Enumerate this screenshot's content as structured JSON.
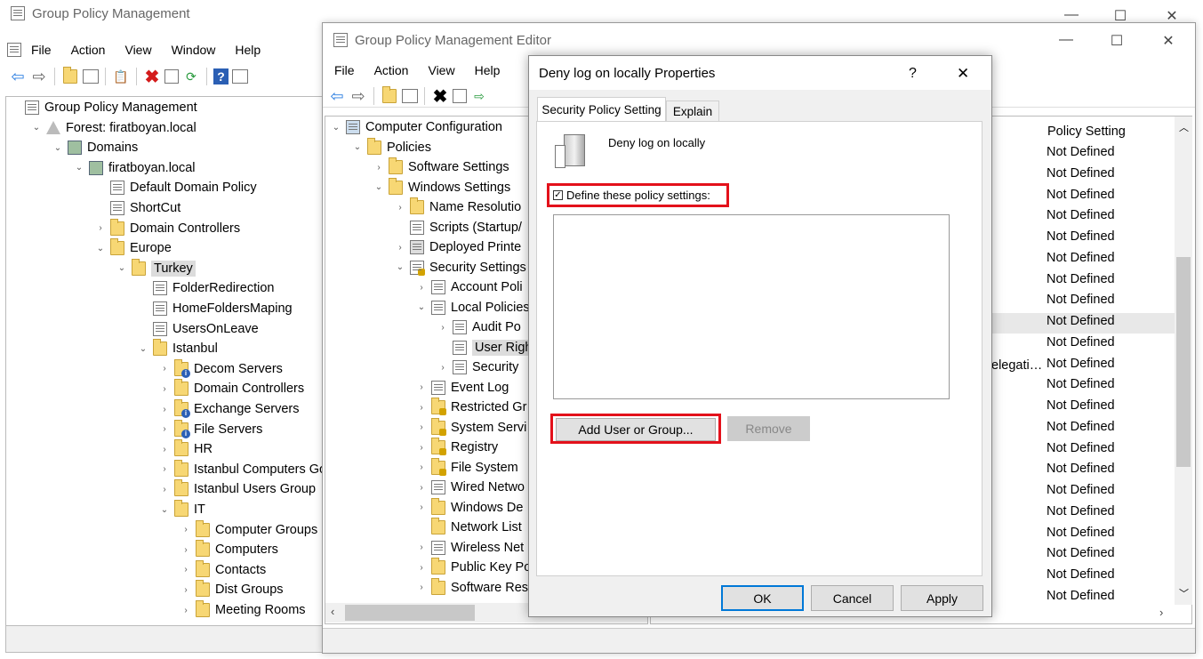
{
  "gpm": {
    "title": "Group Policy Management",
    "menu": [
      "File",
      "Action",
      "View",
      "Window",
      "Help"
    ],
    "tree": [
      {
        "label": "Group Policy Management",
        "indent": 0,
        "icon": "gpm",
        "arrow": ""
      },
      {
        "label": "Forest: firatboyan.local",
        "indent": 1,
        "icon": "forest",
        "arrow": "v"
      },
      {
        "label": "Domains",
        "indent": 2,
        "icon": "domains",
        "arrow": "v"
      },
      {
        "label": "firatboyan.local",
        "indent": 3,
        "icon": "domain",
        "arrow": "v"
      },
      {
        "label": "Default Domain Policy",
        "indent": 4,
        "icon": "gpo",
        "arrow": ""
      },
      {
        "label": "ShortCut",
        "indent": 4,
        "icon": "gpo",
        "arrow": ""
      },
      {
        "label": "Domain Controllers",
        "indent": 4,
        "icon": "folder",
        "arrow": ">"
      },
      {
        "label": "Europe",
        "indent": 4,
        "icon": "folder",
        "arrow": "v"
      },
      {
        "label": "Turkey",
        "indent": 5,
        "icon": "folder",
        "arrow": "v",
        "selected": true
      },
      {
        "label": "FolderRedirection",
        "indent": 6,
        "icon": "gpo",
        "arrow": ""
      },
      {
        "label": "HomeFoldersMaping",
        "indent": 6,
        "icon": "gpo",
        "arrow": ""
      },
      {
        "label": "UsersOnLeave",
        "indent": 6,
        "icon": "gpo",
        "arrow": ""
      },
      {
        "label": "Istanbul",
        "indent": 6,
        "icon": "folder",
        "arrow": "v"
      },
      {
        "label": "Decom Servers",
        "indent": 7,
        "icon": "folder-info",
        "arrow": ">"
      },
      {
        "label": "Domain Controllers",
        "indent": 7,
        "icon": "folder",
        "arrow": ">"
      },
      {
        "label": "Exchange Servers",
        "indent": 7,
        "icon": "folder-info",
        "arrow": ">"
      },
      {
        "label": "File Servers",
        "indent": 7,
        "icon": "folder-info",
        "arrow": ">"
      },
      {
        "label": "HR",
        "indent": 7,
        "icon": "folder",
        "arrow": ">"
      },
      {
        "label": "Istanbul Computers Gorc",
        "indent": 7,
        "icon": "folder",
        "arrow": ">"
      },
      {
        "label": "Istanbul Users Group",
        "indent": 7,
        "icon": "folder",
        "arrow": ">"
      },
      {
        "label": "IT",
        "indent": 7,
        "icon": "folder",
        "arrow": "v"
      },
      {
        "label": "Computer Groups",
        "indent": 8,
        "icon": "folder",
        "arrow": ">"
      },
      {
        "label": "Computers",
        "indent": 8,
        "icon": "folder",
        "arrow": ">"
      },
      {
        "label": "Contacts",
        "indent": 8,
        "icon": "folder",
        "arrow": ">"
      },
      {
        "label": "Dist Groups",
        "indent": 8,
        "icon": "folder",
        "arrow": ">"
      },
      {
        "label": "Meeting Rooms",
        "indent": 8,
        "icon": "folder",
        "arrow": ">"
      }
    ]
  },
  "gpme": {
    "title": "Group Policy Management Editor",
    "menu": [
      "File",
      "Action",
      "View",
      "Help"
    ],
    "tree": [
      {
        "label": "Computer Configuration",
        "indent": 0,
        "icon": "computer",
        "arrow": "v"
      },
      {
        "label": "Policies",
        "indent": 1,
        "icon": "folder",
        "arrow": "v"
      },
      {
        "label": "Software Settings",
        "indent": 2,
        "icon": "folder",
        "arrow": ">"
      },
      {
        "label": "Windows Settings",
        "indent": 2,
        "icon": "folder",
        "arrow": "v"
      },
      {
        "label": "Name Resolutio",
        "indent": 3,
        "icon": "folder",
        "arrow": ">"
      },
      {
        "label": "Scripts (Startup/",
        "indent": 3,
        "icon": "gpo",
        "arrow": ""
      },
      {
        "label": "Deployed Printe",
        "indent": 3,
        "icon": "printer",
        "arrow": ">"
      },
      {
        "label": "Security Settings",
        "indent": 3,
        "icon": "security",
        "arrow": "v"
      },
      {
        "label": "Account Poli",
        "indent": 4,
        "icon": "gpo",
        "arrow": ">"
      },
      {
        "label": "Local Policies",
        "indent": 4,
        "icon": "gpo",
        "arrow": "v"
      },
      {
        "label": "Audit Po",
        "indent": 5,
        "icon": "gpo",
        "arrow": ">"
      },
      {
        "label": "User Righ",
        "indent": 5,
        "icon": "gpo",
        "arrow": "",
        "selected": true
      },
      {
        "label": "Security",
        "indent": 5,
        "icon": "gpo",
        "arrow": ">"
      },
      {
        "label": "Event Log",
        "indent": 4,
        "icon": "gpo",
        "arrow": ">"
      },
      {
        "label": "Restricted Gr",
        "indent": 4,
        "icon": "folder-lock",
        "arrow": ">"
      },
      {
        "label": "System Servi",
        "indent": 4,
        "icon": "folder-lock",
        "arrow": ">"
      },
      {
        "label": "Registry",
        "indent": 4,
        "icon": "folder-lock",
        "arrow": ">"
      },
      {
        "label": "File System",
        "indent": 4,
        "icon": "folder-lock",
        "arrow": ">"
      },
      {
        "label": "Wired Netwo",
        "indent": 4,
        "icon": "gpo",
        "arrow": ">"
      },
      {
        "label": "Windows De",
        "indent": 4,
        "icon": "folder",
        "arrow": ">"
      },
      {
        "label": "Network List",
        "indent": 4,
        "icon": "folder",
        "arrow": ""
      },
      {
        "label": "Wireless Net",
        "indent": 4,
        "icon": "gpo",
        "arrow": ">"
      },
      {
        "label": "Public Key Po",
        "indent": 4,
        "icon": "folder",
        "arrow": ">"
      },
      {
        "label": "Software Res",
        "indent": 4,
        "icon": "folder",
        "arrow": ">"
      }
    ],
    "right_header": "Policy Setting",
    "right_fragment": "elegati…",
    "policy_values": [
      "Not Defined",
      "Not Defined",
      "Not Defined",
      "Not Defined",
      "Not Defined",
      "Not Defined",
      "Not Defined",
      "Not Defined",
      "Not Defined",
      "Not Defined",
      "Not Defined",
      "Not Defined",
      "Not Defined",
      "Not Defined",
      "Not Defined",
      "Not Defined",
      "Not Defined",
      "Not Defined",
      "Not Defined",
      "Not Defined",
      "Not Defined",
      "Not Defined"
    ]
  },
  "dialog": {
    "title": "Deny log on locally Properties",
    "help_glyph": "?",
    "close_glyph": "✕",
    "tabs": [
      "Security Policy Setting",
      "Explain"
    ],
    "policy_name": "Deny log on locally",
    "checkbox_label": "Define these policy settings:",
    "checkbox_checked": true,
    "add_button": "Add User or Group...",
    "remove_button": "Remove",
    "ok_button": "OK",
    "cancel_button": "Cancel",
    "apply_button": "Apply"
  }
}
